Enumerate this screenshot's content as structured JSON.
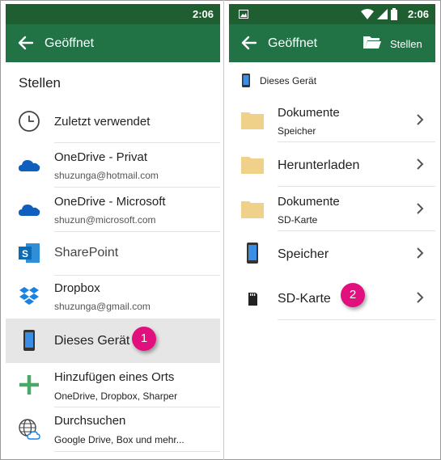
{
  "left": {
    "status": {
      "time": "2:06"
    },
    "appbar": {
      "title": "Geöffnet"
    },
    "section_title": "Stellen",
    "items": [
      {
        "label": "Zuletzt verwendet",
        "sub": ""
      },
      {
        "label": "OneDrive -  Privat",
        "sub": "shuzunga@hotmail.com"
      },
      {
        "label": "OneDrive - Microsoft",
        "sub": "shuzun@microsoft.com"
      },
      {
        "label": "SharePoint",
        "sub": ""
      },
      {
        "label": "Dropbox",
        "sub": "shuzunga@gmail.com"
      },
      {
        "label": "Dieses Gerät",
        "sub": ""
      },
      {
        "label": "Hinzufügen eines Orts",
        "sub": "OneDrive, Dropbox, Sharper"
      },
      {
        "label": "Durchsuchen",
        "sub": "Google Drive, Box und mehr..."
      }
    ],
    "badge": "1"
  },
  "right": {
    "status": {
      "time": "2:06"
    },
    "appbar": {
      "title": "Geöffnet",
      "action": "Stellen"
    },
    "device_header": "Dieses Gerät",
    "items": [
      {
        "label": "Dokumente",
        "sub": "Speicher"
      },
      {
        "label": "Herunterladen",
        "sub": ""
      },
      {
        "label": "Dokumente",
        "sub": "SD-Karte"
      },
      {
        "label": "Speicher",
        "sub": ""
      },
      {
        "label": "SD-Karte",
        "sub": ""
      }
    ],
    "badge": "2"
  },
  "colors": {
    "status_bar": "#1e5e30",
    "app_bar": "#217346",
    "badge": "#e0117f",
    "onedrive": "#0f5fbf",
    "sharepoint": "#0b6bb5",
    "dropbox": "#1a82e2",
    "folder": "#f0d18a",
    "add": "#4aa868"
  }
}
